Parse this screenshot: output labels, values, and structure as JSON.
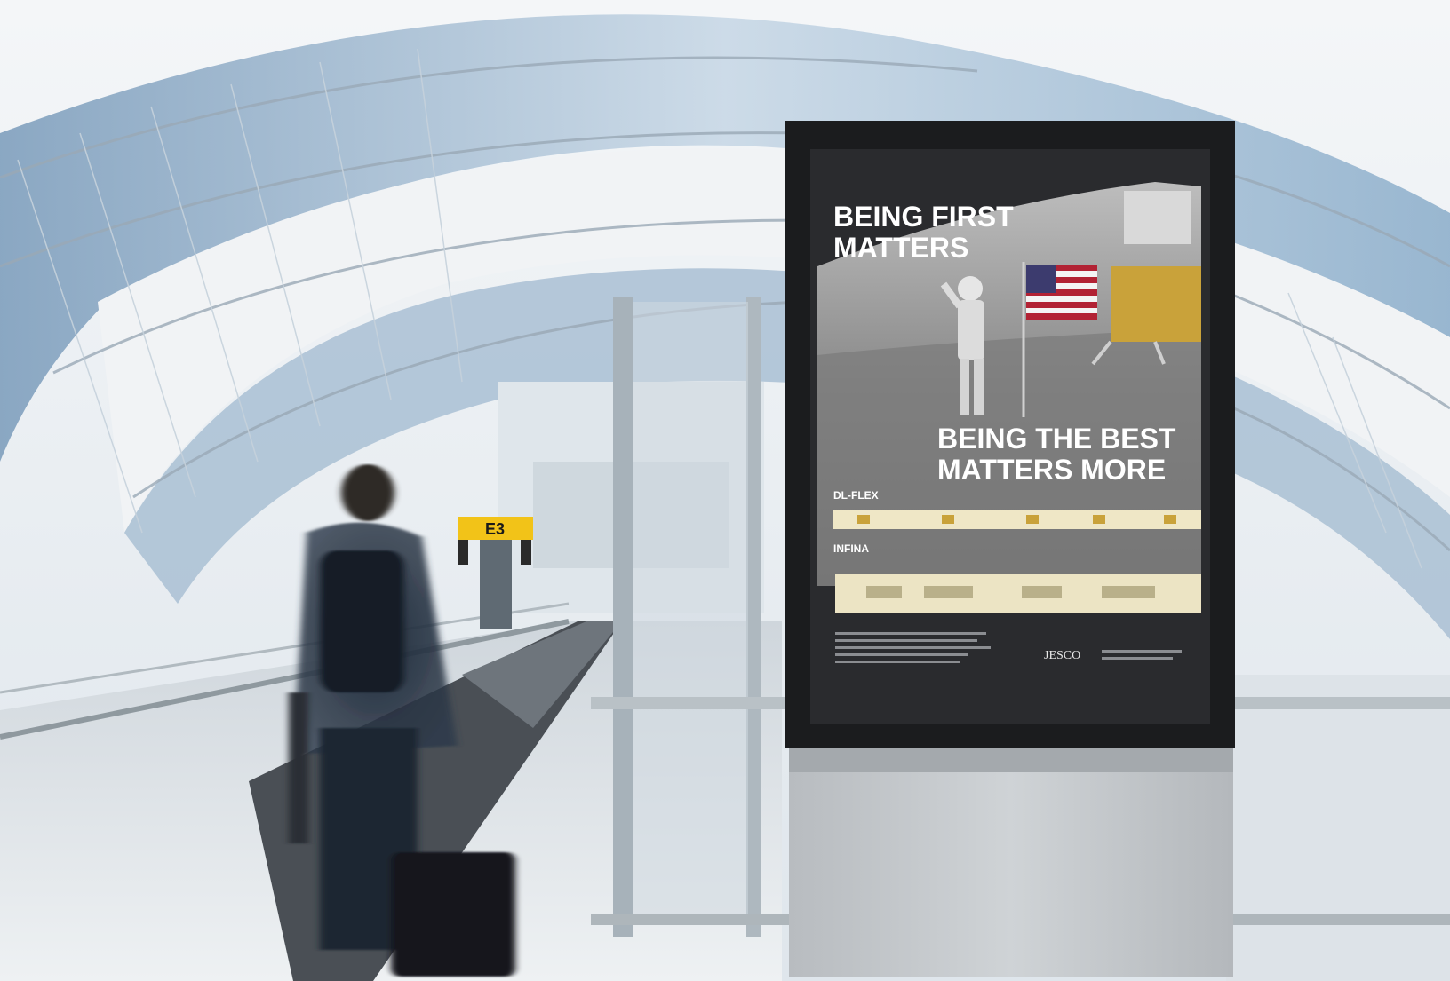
{
  "gate_sign": {
    "label": "E3",
    "color": "#f2c318"
  },
  "poster": {
    "headline_line1": "BEING FIRST",
    "headline_line2": "MATTERS",
    "subhead_line1": "BEING THE BEST",
    "subhead_line2": "MATTERS MORE",
    "product_label_1": "DL-FLEX",
    "product_label_2": "INFINA",
    "brand": "JESCO"
  },
  "colors": {
    "sign_yellow": "#f2c318",
    "poster_frame": "#1b1c1e",
    "poster_bg": "#2a2b2e",
    "accent_gold": "#c9a23a"
  }
}
